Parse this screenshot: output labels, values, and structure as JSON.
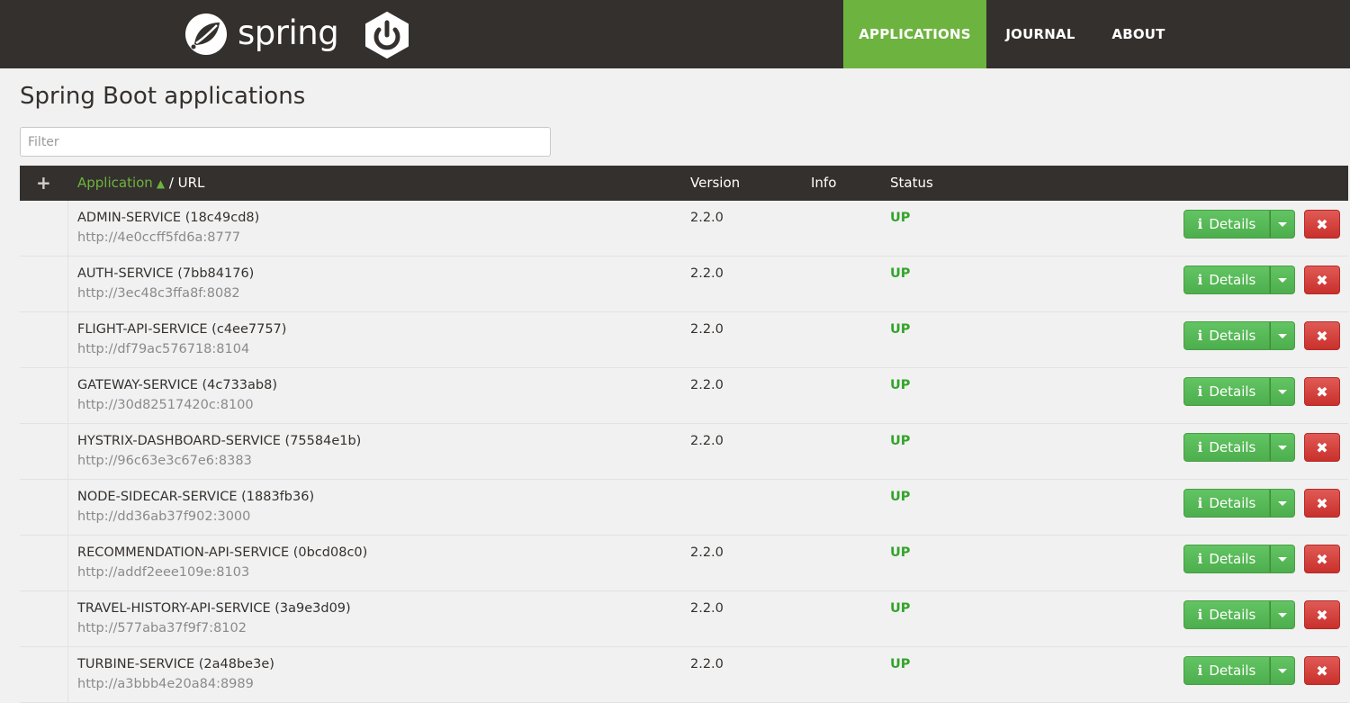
{
  "nav": {
    "brand_word": "spring",
    "items": [
      {
        "label": "APPLICATIONS",
        "active": true
      },
      {
        "label": "JOURNAL",
        "active": false
      },
      {
        "label": "ABOUT",
        "active": false
      }
    ]
  },
  "colors": {
    "navbar": "#34302d",
    "accent": "#6db33f",
    "status_up": "#34a32b",
    "details_button": "#5cb85c",
    "remove_button": "#d9534f"
  },
  "page": {
    "title": "Spring Boot applications",
    "filter_placeholder": "Filter"
  },
  "table": {
    "headers": {
      "expand": "+",
      "application": "Application",
      "sort_indicator": "▲",
      "url": " / URL",
      "version": "Version",
      "info": "Info",
      "status": "Status"
    },
    "details_label": "Details",
    "icons": {
      "details": "info-icon",
      "dropdown": "caret-down-icon",
      "remove": "close-icon"
    },
    "rows": [
      {
        "name": "ADMIN-SERVICE (18c49cd8)",
        "url": "http://4e0ccff5fd6a:8777",
        "version": "2.2.0",
        "status": "UP"
      },
      {
        "name": "AUTH-SERVICE (7bb84176)",
        "url": "http://3ec48c3ffa8f:8082",
        "version": "2.2.0",
        "status": "UP"
      },
      {
        "name": "FLIGHT-API-SERVICE (c4ee7757)",
        "url": "http://df79ac576718:8104",
        "version": "2.2.0",
        "status": "UP"
      },
      {
        "name": "GATEWAY-SERVICE (4c733ab8)",
        "url": "http://30d82517420c:8100",
        "version": "2.2.0",
        "status": "UP"
      },
      {
        "name": "HYSTRIX-DASHBOARD-SERVICE (75584e1b)",
        "url": "http://96c63e3c67e6:8383",
        "version": "2.2.0",
        "status": "UP"
      },
      {
        "name": "NODE-SIDECAR-SERVICE (1883fb36)",
        "url": "http://dd36ab37f902:3000",
        "version": "",
        "status": "UP"
      },
      {
        "name": "RECOMMENDATION-API-SERVICE (0bcd08c0)",
        "url": "http://addf2eee109e:8103",
        "version": "2.2.0",
        "status": "UP"
      },
      {
        "name": "TRAVEL-HISTORY-API-SERVICE (3a9e3d09)",
        "url": "http://577aba37f9f7:8102",
        "version": "2.2.0",
        "status": "UP"
      },
      {
        "name": "TURBINE-SERVICE (2a48be3e)",
        "url": "http://a3bbb4e20a84:8989",
        "version": "2.2.0",
        "status": "UP"
      }
    ]
  }
}
